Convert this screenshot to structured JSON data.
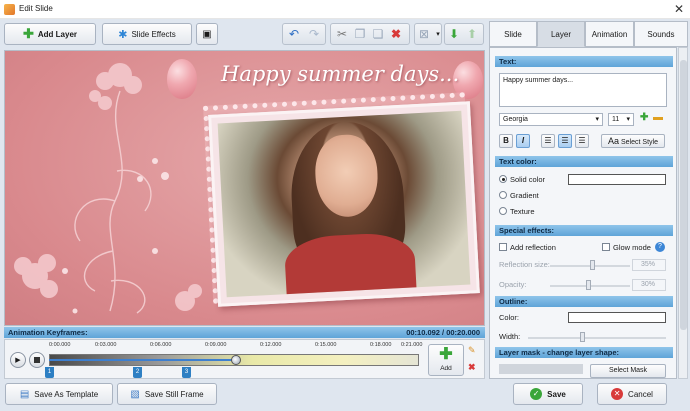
{
  "window": {
    "title": "Edit Slide"
  },
  "toolbar": {
    "add_layer": "Add Layer",
    "slide_effects": "Slide Effects"
  },
  "canvas": {
    "headline": "Happy summer days..."
  },
  "keyframes": {
    "title": "Animation Keyframes:",
    "time": "00:10.092 / 00:20.000",
    "ticks": [
      "0:00.000",
      "0:03.000",
      "0:06.000",
      "0:09.000",
      "0:12.000",
      "0:15.000",
      "0:18.000",
      "0:21.000"
    ],
    "markers": [
      "1",
      "2",
      "3"
    ],
    "add_label": "Add"
  },
  "bottom": {
    "save_template": "Save As Template",
    "save_still": "Save Still Frame",
    "save": "Save",
    "cancel": "Cancel"
  },
  "tabs": [
    "Slide",
    "Layer",
    "Animation",
    "Sounds"
  ],
  "panel": {
    "text_section": "Text:",
    "text_value": "Happy summer days...",
    "font": "Georgia",
    "font_size": "11",
    "bold": "B",
    "italic": "I",
    "select_style": "Select Style",
    "text_color_section": "Text color:",
    "solid_color": "Solid color",
    "gradient": "Gradient",
    "texture": "Texture",
    "special_section": "Special effects:",
    "add_reflection": "Add reflection",
    "glow_mode": "Glow mode",
    "reflection_size": "Reflection size:",
    "reflection_value": "35%",
    "opacity": "Opacity:",
    "opacity_value": "30%",
    "outline_section": "Outline:",
    "color": "Color:",
    "width": "Width:",
    "mask_section": "Layer mask - change layer shape:",
    "select_mask": "Select Mask"
  },
  "colors": {
    "accent": "#5fa4d8",
    "canvas_bg": "#d9898d",
    "text_color": "#ffffff"
  }
}
